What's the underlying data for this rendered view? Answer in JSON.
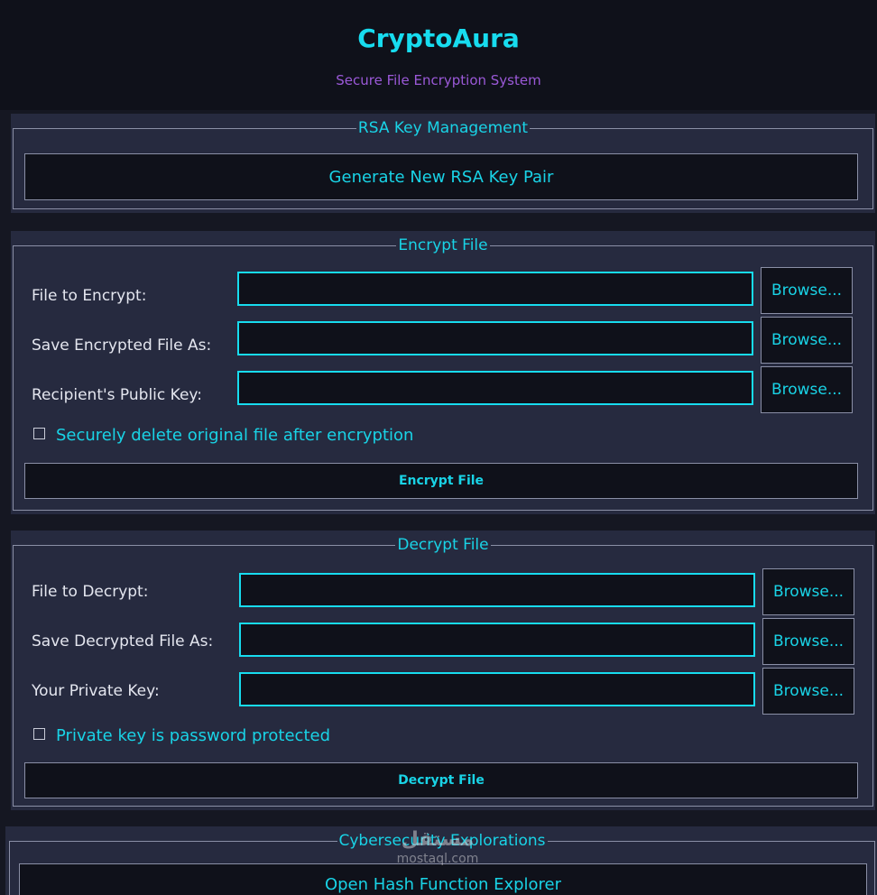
{
  "app": {
    "title": "CryptoAura",
    "subtitle": "Secure File Encryption System"
  },
  "rsa": {
    "legend": "RSA Key Management",
    "generate_label": "Generate New RSA Key Pair"
  },
  "encrypt": {
    "legend": "Encrypt File",
    "rows": [
      {
        "label": "File to Encrypt:",
        "value": "",
        "browse": "Browse..."
      },
      {
        "label": "Save Encrypted File As:",
        "value": "",
        "browse": "Browse..."
      },
      {
        "label": "Recipient's Public Key:",
        "value": "",
        "browse": "Browse..."
      }
    ],
    "checkbox_label": "Securely delete original file after encryption",
    "checkbox_checked": false,
    "button_label": "Encrypt File"
  },
  "decrypt": {
    "legend": "Decrypt File",
    "rows": [
      {
        "label": "File to Decrypt:",
        "value": "",
        "browse": "Browse..."
      },
      {
        "label": "Save Decrypted File As:",
        "value": "",
        "browse": "Browse..."
      },
      {
        "label": "Your Private Key:",
        "value": "",
        "browse": "Browse..."
      }
    ],
    "checkbox_label": "Private key is password protected",
    "checkbox_checked": false,
    "button_label": "Decrypt File"
  },
  "explorations": {
    "legend": "Cybersecurity Explorations",
    "hash_button_label": "Open Hash Function Explorer"
  },
  "watermark": {
    "arabic": "مستقل",
    "latin": "mostaql.com"
  },
  "colors": {
    "accent": "#17dcef",
    "subtitle": "#9b59d8",
    "panel": "#262a3f",
    "background": "#151722",
    "input_bg": "#0f111a"
  }
}
